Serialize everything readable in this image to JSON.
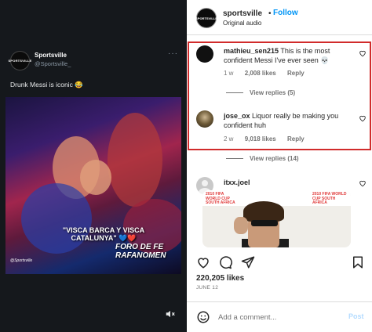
{
  "tweet": {
    "avatar_text": "SPORTSVILLE",
    "name": "Sportsville",
    "handle": "@Sportsville_",
    "more": "···",
    "text": "Drunk Messi is iconic 😂",
    "video": {
      "caption_line1": "\"VISCA BARCA Y VISCA CATALUNYA\" 💙❤️",
      "caption_line2": "FORO DE FE RAFANOMEN",
      "watermark": "@Sportsville"
    },
    "mute_icon": "speaker-mute-icon"
  },
  "post": {
    "username": "sportsville",
    "dot": "•",
    "follow_label": "Follow",
    "audio": "Original audio",
    "comments": [
      {
        "username": "mathieu_sen215",
        "text": "This is the most confident Messi I've ever seen 💀",
        "time": "1 w",
        "likes": "2,008 likes",
        "reply": "Reply",
        "view_replies": "View replies (5)"
      },
      {
        "username": "jose_ox",
        "text": "Liquor really be making you confident huh",
        "time": "2 w",
        "likes": "9,018 likes",
        "reply": "Reply",
        "view_replies": "View replies (14)"
      },
      {
        "username": "itxx.joel",
        "text": "",
        "meme_banner_left": "2010 FIFA WORLD CUP SOUTH AFRICA",
        "meme_banner_right": "2010 FIFA WORLD CUP SOUTH AFRICA"
      }
    ],
    "likes": "220,205 likes",
    "date": "JUNE 12",
    "comment_placeholder": "Add a comment...",
    "post_label": "Post"
  },
  "colors": {
    "accent": "#0095f6",
    "highlight": "#d12b2b",
    "tweet_bg": "#15181c"
  }
}
